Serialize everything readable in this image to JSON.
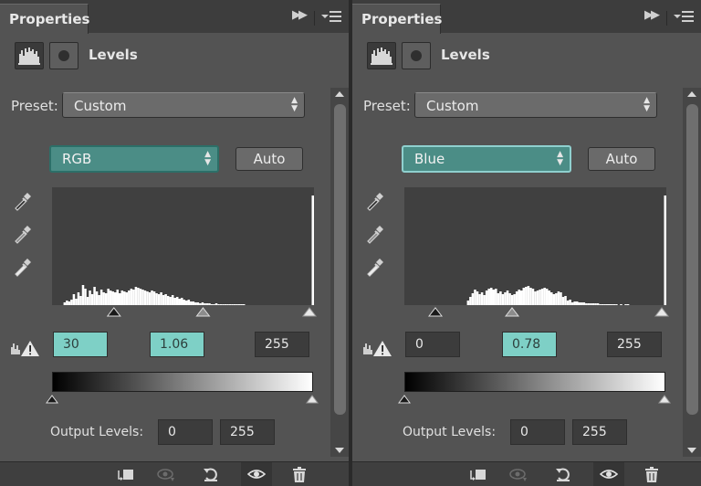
{
  "panels": [
    {
      "tab_title": "Properties",
      "title": "Levels",
      "preset_label": "Preset:",
      "preset_value": "Custom",
      "channel": "RGB",
      "auto_label": "Auto",
      "input_black": "30",
      "input_gamma": "1.06",
      "input_white": "255",
      "output_label": "Output Levels:",
      "output_min": "0",
      "output_max": "255",
      "black_highlighted": true,
      "histogram": [
        0,
        0,
        0,
        0,
        0,
        3,
        5,
        4,
        6,
        12,
        7,
        14,
        10,
        22,
        18,
        9,
        16,
        12,
        20,
        15,
        11,
        17,
        14,
        13,
        18,
        16,
        15,
        14,
        17,
        13,
        16,
        15,
        14,
        16,
        18,
        17,
        20,
        19,
        18,
        17,
        16,
        15,
        14,
        16,
        15,
        13,
        12,
        14,
        11,
        12,
        10,
        9,
        11,
        8,
        9,
        7,
        8,
        6,
        5,
        6,
        4,
        4,
        3,
        3,
        2,
        3,
        2,
        2,
        2,
        1,
        1,
        2,
        1,
        1,
        1,
        1,
        1,
        1,
        1,
        1,
        1,
        1,
        1,
        1,
        0,
        0,
        0,
        0,
        0,
        0,
        0,
        0,
        0,
        0,
        0,
        0,
        0,
        0,
        0,
        0,
        0,
        0,
        0,
        0,
        0,
        0,
        0,
        0,
        0,
        0,
        0,
        0,
        0,
        120
      ],
      "black_slider": 30,
      "gamma_slider": 1.06
    },
    {
      "tab_title": "Properties",
      "title": "Levels",
      "preset_label": "Preset:",
      "preset_value": "Custom",
      "channel": "Blue",
      "auto_label": "Auto",
      "input_black": "0",
      "input_gamma": "0.78",
      "input_white": "255",
      "output_label": "Output Levels:",
      "output_min": "0",
      "output_max": "255",
      "black_highlighted": false,
      "histogram": [
        0,
        0,
        0,
        0,
        0,
        0,
        0,
        0,
        0,
        0,
        0,
        0,
        0,
        0,
        0,
        0,
        0,
        0,
        0,
        0,
        0,
        0,
        0,
        0,
        0,
        0,
        0,
        5,
        9,
        13,
        17,
        15,
        12,
        14,
        11,
        16,
        18,
        19,
        17,
        18,
        13,
        15,
        12,
        14,
        16,
        13,
        11,
        12,
        15,
        17,
        16,
        19,
        20,
        21,
        19,
        18,
        15,
        16,
        17,
        18,
        19,
        18,
        16,
        14,
        12,
        13,
        15,
        14,
        9,
        10,
        5,
        6,
        3,
        4,
        4,
        3,
        3,
        3,
        2,
        2,
        2,
        2,
        2,
        2,
        1,
        1,
        1,
        1,
        1,
        1,
        1,
        1,
        0,
        1,
        0,
        1,
        1,
        0,
        0,
        0,
        0,
        0,
        0,
        0,
        0,
        0,
        0,
        0,
        0,
        0,
        0,
        0,
        120
      ],
      "black_slider": 0,
      "gamma_slider": 0.78
    }
  ],
  "colors": {
    "panel_bg": "#535353",
    "accent_teal": "#4b8d86",
    "field_highlight": "#7ed0c6",
    "histogram_bg": "#404040"
  },
  "icons": {
    "levels_type": "histogram-icon",
    "mask": "mask-icon",
    "eyedroppers": [
      "black-point-eyedropper-icon",
      "gray-point-eyedropper-icon",
      "white-point-eyedropper-icon"
    ],
    "footer": [
      "clip-to-layer-icon",
      "view-previous-state-icon",
      "reset-icon",
      "visibility-eye-icon",
      "trash-icon"
    ]
  }
}
